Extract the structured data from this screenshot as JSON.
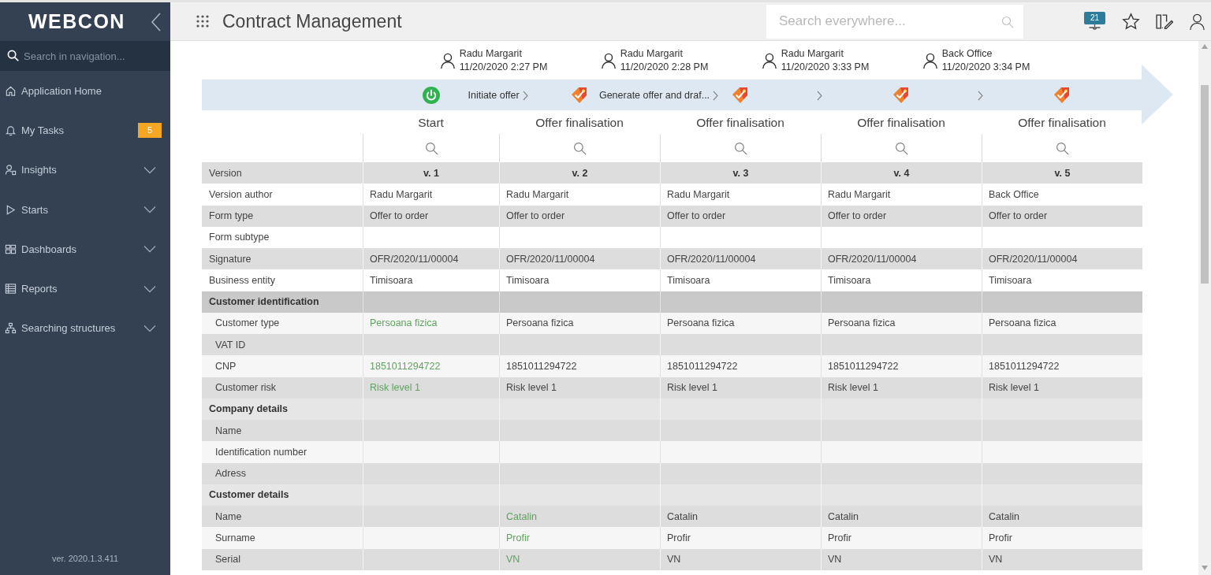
{
  "sidebar": {
    "logo": "WEBCON",
    "search": {
      "placeholder": "Search in navigation..."
    },
    "items": [
      {
        "kind": "link",
        "label": "Application Home"
      },
      {
        "kind": "link",
        "label": "My Tasks",
        "badge": "5"
      },
      {
        "kind": "group",
        "label": "Insights",
        "expanded": false
      },
      {
        "kind": "group",
        "label": "Starts",
        "expanded": false
      },
      {
        "kind": "group",
        "label": "Dashboards",
        "expanded": false
      },
      {
        "kind": "group",
        "label": "Reports",
        "expanded": false
      },
      {
        "kind": "group",
        "label": "Searching structures",
        "expanded": false
      }
    ],
    "version": "ver. 2020.1.3.411"
  },
  "header": {
    "title": "Contract Management",
    "search": {
      "placeholder": "Search everywhere..."
    },
    "notification_badge": "21"
  },
  "history": {
    "transitions": [
      {
        "author": "Radu Margarit",
        "date": "11/20/2020 2:27 PM",
        "label": "Initiate offer"
      },
      {
        "author": "Radu Margarit",
        "date": "11/20/2020 2:28 PM",
        "label": "Generate offer and draf..."
      },
      {
        "author": "Radu Margarit",
        "date": "11/20/2020 3:33 PM"
      },
      {
        "author": "Back Office",
        "date": "11/20/2020 3:34 PM"
      }
    ],
    "steps": [
      {
        "kind": "start",
        "name": "Start"
      },
      {
        "kind": "task",
        "name": "Offer finalisation"
      },
      {
        "kind": "task",
        "name": "Offer finalisation"
      },
      {
        "kind": "task",
        "name": "Offer finalisation"
      },
      {
        "kind": "task",
        "name": "Offer finalisation"
      }
    ]
  },
  "table": {
    "rows": [
      {
        "kind": "version",
        "label": "Version",
        "cells": [
          {
            "text": "v. 1",
            "changed": false
          },
          {
            "text": "v. 2",
            "changed": false
          },
          {
            "text": "v. 3",
            "changed": false
          },
          {
            "text": "v. 4",
            "changed": false
          },
          {
            "text": "v. 5",
            "changed": false
          }
        ]
      },
      {
        "kind": "field",
        "label": "Version author",
        "cells": [
          {
            "text": "Radu Margarit",
            "changed": false
          },
          {
            "text": "Radu Margarit",
            "changed": false
          },
          {
            "text": "Radu Margarit",
            "changed": false
          },
          {
            "text": "Radu Margarit",
            "changed": false
          },
          {
            "text": "Back Office",
            "changed": false
          }
        ]
      },
      {
        "kind": "field",
        "label": "Form type",
        "cells": [
          {
            "text": "Offer to order",
            "changed": false
          },
          {
            "text": "Offer to order",
            "changed": false
          },
          {
            "text": "Offer to order",
            "changed": false
          },
          {
            "text": "Offer to order",
            "changed": false
          },
          {
            "text": "Offer to order",
            "changed": false
          }
        ]
      },
      {
        "kind": "field",
        "label": "Form subtype",
        "cells": [
          null,
          null,
          null,
          null,
          null
        ]
      },
      {
        "kind": "field",
        "label": "Signature",
        "cells": [
          {
            "text": "OFR/2020/11/00004",
            "changed": false
          },
          {
            "text": "OFR/2020/11/00004",
            "changed": false
          },
          {
            "text": "OFR/2020/11/00004",
            "changed": false
          },
          {
            "text": "OFR/2020/11/00004",
            "changed": false
          },
          {
            "text": "OFR/2020/11/00004",
            "changed": false
          }
        ]
      },
      {
        "kind": "field",
        "label": "Business entity",
        "cells": [
          {
            "text": "Timisoara",
            "changed": false
          },
          {
            "text": "Timisoara",
            "changed": false
          },
          {
            "text": "Timisoara",
            "changed": false
          },
          {
            "text": "Timisoara",
            "changed": false
          },
          {
            "text": "Timisoara",
            "changed": false
          }
        ]
      },
      {
        "kind": "section",
        "label": "Customer identification",
        "children": [
          {
            "kind": "field",
            "label": "Customer type",
            "cells": [
              {
                "text": "Persoana fizica",
                "changed": true
              },
              {
                "text": "Persoana fizica",
                "changed": false
              },
              {
                "text": "Persoana fizica",
                "changed": false
              },
              {
                "text": "Persoana fizica",
                "changed": false
              },
              {
                "text": "Persoana fizica",
                "changed": false
              }
            ]
          },
          {
            "kind": "field",
            "label": "VAT ID",
            "cells": [
              null,
              null,
              null,
              null,
              null
            ]
          },
          {
            "kind": "field",
            "label": "CNP",
            "cells": [
              {
                "text": "1851011294722",
                "changed": true
              },
              {
                "text": "1851011294722",
                "changed": false
              },
              {
                "text": "1851011294722",
                "changed": false
              },
              {
                "text": "1851011294722",
                "changed": false
              },
              {
                "text": "1851011294722",
                "changed": false
              }
            ]
          },
          {
            "kind": "field",
            "label": "Customer risk",
            "cells": [
              {
                "text": "Risk level 1",
                "changed": true
              },
              {
                "text": "Risk level 1",
                "changed": false
              },
              {
                "text": "Risk level 1",
                "changed": false
              },
              {
                "text": "Risk level 1",
                "changed": false
              },
              {
                "text": "Risk level 1",
                "changed": false
              }
            ]
          }
        ]
      },
      {
        "kind": "section",
        "label": "Company details",
        "children": [
          {
            "kind": "field",
            "label": "Name",
            "cells": [
              null,
              null,
              null,
              null,
              null
            ]
          },
          {
            "kind": "field",
            "label": "Identification number",
            "cells": [
              null,
              null,
              null,
              null,
              null
            ]
          },
          {
            "kind": "field",
            "label": "Adress",
            "cells": [
              null,
              null,
              null,
              null,
              null
            ]
          }
        ]
      },
      {
        "kind": "section",
        "label": "Customer details",
        "children": [
          {
            "kind": "field",
            "label": "Name",
            "cells": [
              null,
              {
                "text": "Catalin",
                "changed": true
              },
              {
                "text": "Catalin",
                "changed": false
              },
              {
                "text": "Catalin",
                "changed": false
              },
              {
                "text": "Catalin",
                "changed": false
              }
            ]
          },
          {
            "kind": "field",
            "label": "Surname",
            "cells": [
              null,
              {
                "text": "Profir",
                "changed": true
              },
              {
                "text": "Profir",
                "changed": false
              },
              {
                "text": "Profir",
                "changed": false
              },
              {
                "text": "Profir",
                "changed": false
              }
            ]
          },
          {
            "kind": "field",
            "label": "Serial",
            "cells": [
              null,
              {
                "text": "VN",
                "changed": true
              },
              {
                "text": "VN",
                "changed": false
              },
              {
                "text": "VN",
                "changed": false
              },
              {
                "text": "VN",
                "changed": false
              }
            ]
          }
        ]
      }
    ]
  }
}
